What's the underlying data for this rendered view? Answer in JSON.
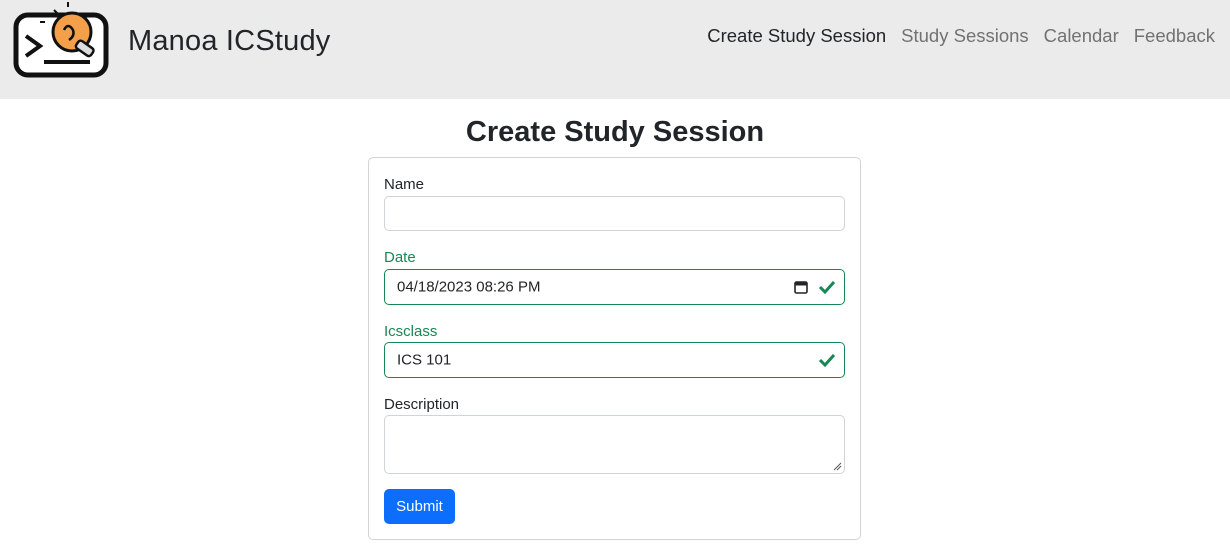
{
  "navbar": {
    "brand": "Manoa ICStudy",
    "links": [
      {
        "label": "Create Study Session",
        "active": true
      },
      {
        "label": "Study Sessions",
        "active": false
      },
      {
        "label": "Calendar",
        "active": false
      },
      {
        "label": "Feedback",
        "active": false
      }
    ]
  },
  "page": {
    "title": "Create Study Session"
  },
  "form": {
    "name": {
      "label": "Name",
      "value": ""
    },
    "date": {
      "label": "Date",
      "value": "04/18/2023 08:26 PM",
      "valid": true
    },
    "icsclass": {
      "label": "Icsclass",
      "value": "ICS 101",
      "valid": true
    },
    "description": {
      "label": "Description",
      "value": ""
    },
    "submit_label": "Submit"
  },
  "colors": {
    "navbar_bg": "#ebebeb",
    "valid_green": "#198754",
    "primary_blue": "#0d6efd",
    "logo_orange": "#f4a04a"
  },
  "icons": {
    "logo": "terminal-lightbulb-logo",
    "valid": "checkmark-icon",
    "calendar": "calendar-icon"
  }
}
